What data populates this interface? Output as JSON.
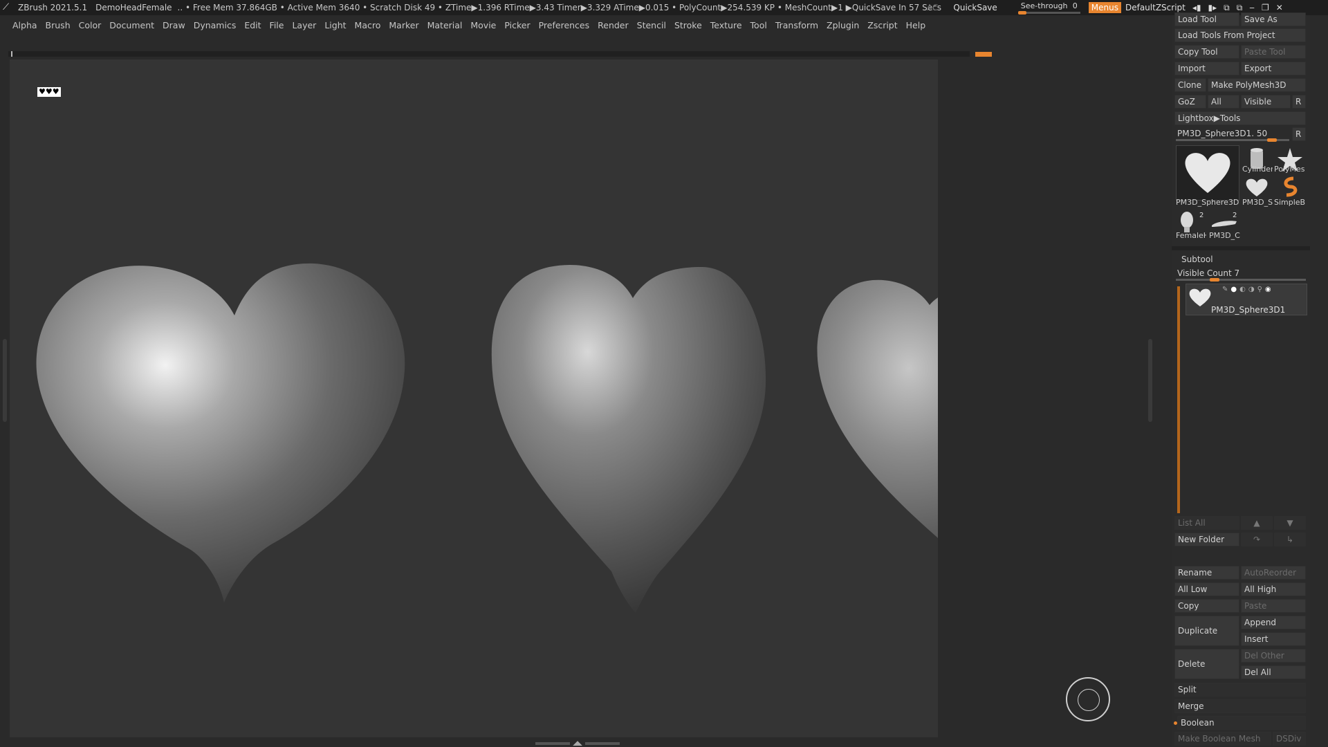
{
  "titlebar": {
    "app_version": "ZBrush 2021.5.1",
    "project": "DemoHeadFemale",
    "stats": ".. • Free Mem 37.864GB • Active Mem 3640 • Scratch Disk 49 • ZTime▶1.396 RTime▶3.43 Timer▶3.329 ATime▶0.015 • PolyCount▶254.539 KP • MeshCount▶1 ▶QuickSave In 57 Secs",
    "ac_label": "AC",
    "quicksave_label": "QuickSave",
    "seethrough_label": "See-through",
    "seethrough_value": "0",
    "menus_label": "Menus",
    "default_zscript_label": "DefaultZScript"
  },
  "menubar": {
    "items": [
      "Alpha",
      "Brush",
      "Color",
      "Document",
      "Draw",
      "Dynamics",
      "Edit",
      "File",
      "Layer",
      "Light",
      "Macro",
      "Marker",
      "Material",
      "Movie",
      "Picker",
      "Preferences",
      "Render",
      "Stencil",
      "Stroke",
      "Texture",
      "Tool",
      "Transform",
      "Zplugin",
      "Zscript",
      "Help"
    ]
  },
  "canvas": {
    "badge_text": "♥♥♥",
    "accent_color": "#e8852f"
  },
  "tool_panel": {
    "load_tool": "Load Tool",
    "save_as": "Save As",
    "load_tools_from_project": "Load Tools From Project",
    "copy_tool": "Copy Tool",
    "paste_tool": "Paste Tool",
    "import": "Import",
    "export": "Export",
    "clone": "Clone",
    "make_polymesh3d": "Make PolyMesh3D",
    "goz": "GoZ",
    "all": "All",
    "visible": "Visible",
    "r": "R",
    "lightbox_tools": "Lightbox▶Tools",
    "current_tool_name": "PM3D_Sphere3D1. 50",
    "current_tool_slider_value": 0.85,
    "thumbs": {
      "main": "PM3D_Sphere3D",
      "cylinder": "Cylinder",
      "polymesh": "PolyMes",
      "pm3d_s": "PM3D_S",
      "simpleb": "SimpleB",
      "female": "FemaleH",
      "pm3d_c": "PM3D_C",
      "female_count": "2",
      "pm3d_c_count": "2"
    }
  },
  "subtool_panel": {
    "title": "Subtool",
    "visible_count_label": "Visible Count 7",
    "visible_count_slider": 0.3,
    "item_name": "PM3D_Sphere3D1",
    "list_all": "List All",
    "new_folder": "New Folder",
    "rename": "Rename",
    "autoreorder": "AutoReorder",
    "all_low": "All Low",
    "all_high": "All High",
    "copy": "Copy",
    "paste": "Paste",
    "duplicate": "Duplicate",
    "append": "Append",
    "insert": "Insert",
    "delete": "Delete",
    "del_other": "Del Other",
    "del_all": "Del All",
    "split": "Split",
    "merge": "Merge",
    "boolean": "Boolean",
    "make_boolean_mesh": "Make Boolean Mesh",
    "dsdiv": "DSDiv"
  }
}
